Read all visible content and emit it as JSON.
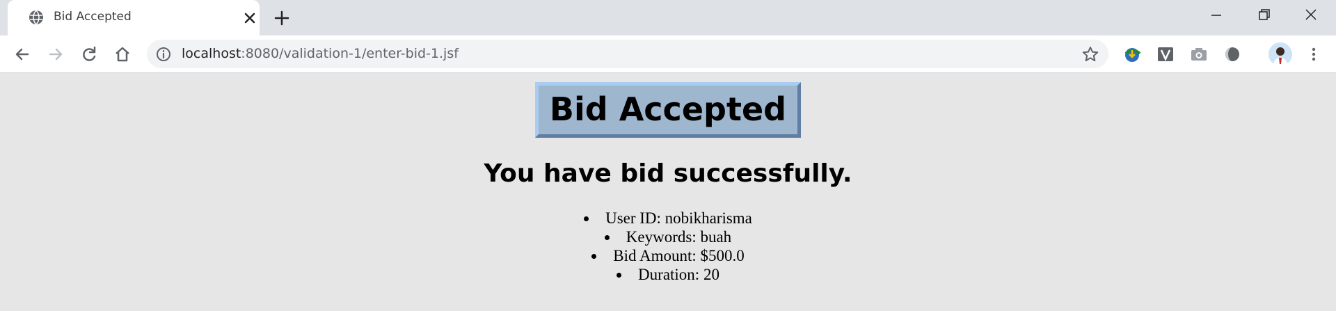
{
  "browser": {
    "tab_title": "Bid Accepted",
    "url_host": "localhost",
    "url_rest": ":8080/validation-1/enter-bid-1.jsf",
    "icons": {
      "favicon": "globe-icon",
      "close": "close-icon",
      "new_tab": "plus-icon",
      "back": "arrow-left-icon",
      "forward": "arrow-right-icon",
      "reload": "reload-icon",
      "home": "home-icon",
      "info": "info-icon",
      "bookmark": "star-icon",
      "menu": "kebab-menu-icon"
    }
  },
  "page": {
    "heading": "Bid Accepted",
    "subheading": "You have bid successfully.",
    "details": [
      "User ID: nobikharisma",
      "Keywords: buah",
      "Bid Amount: $500.0",
      "Duration: 20"
    ]
  },
  "colors": {
    "page_background": "#e6e6e6",
    "heading_box": "#9fb6cf"
  }
}
